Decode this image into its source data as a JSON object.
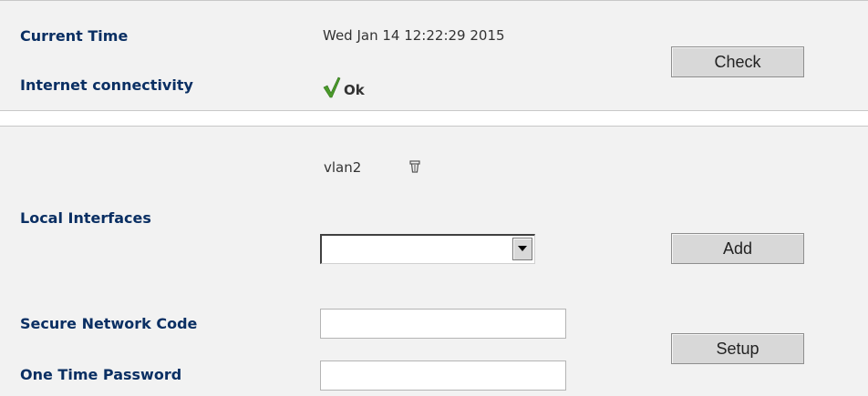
{
  "status": {
    "current_time_label": "Current Time",
    "current_time_value": "Wed Jan 14 12:22:29 2015",
    "connectivity_label": "Internet connectivity",
    "connectivity_value": "Ok",
    "connectivity_icon": "checkmark-icon",
    "connectivity_icon_color": "#4a9a2a",
    "check_button": "Check"
  },
  "network": {
    "local_interfaces_label": "Local Interfaces",
    "interfaces": [
      {
        "name": "vlan2",
        "icon": "trash-icon"
      }
    ],
    "interface_select_value": "",
    "add_button": "Add",
    "secure_network_code_label": "Secure Network Code",
    "secure_network_code_value": "",
    "one_time_password_label": "One Time Password",
    "one_time_password_value": "",
    "setup_button": "Setup"
  },
  "colors": {
    "label_color": "#0a2f63",
    "panel_background": "#f2f2f2",
    "button_background": "#d8d8d8"
  }
}
